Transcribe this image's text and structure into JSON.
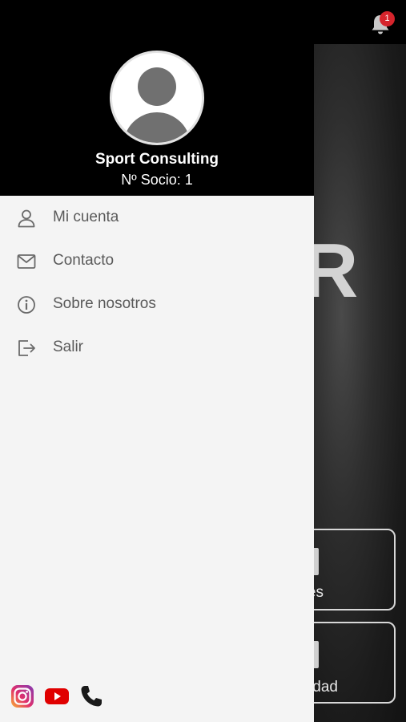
{
  "notifications": {
    "count": "1"
  },
  "background": {
    "hero_letter": "R",
    "tiles": [
      {
        "label": "es"
      },
      {
        "label": "dad"
      }
    ]
  },
  "drawer": {
    "user": {
      "name": "Sport Consulting",
      "member_no": "Nº Socio: 1"
    },
    "menu": [
      {
        "label": "Mi cuenta",
        "icon": "user-icon"
      },
      {
        "label": "Contacto",
        "icon": "mail-icon"
      },
      {
        "label": "Sobre nosotros",
        "icon": "info-icon"
      },
      {
        "label": "Salir",
        "icon": "logout-icon"
      }
    ],
    "social": [
      {
        "name": "instagram-icon"
      },
      {
        "name": "youtube-icon"
      },
      {
        "name": "phone-icon"
      }
    ]
  },
  "colors": {
    "accent_badge": "#d5242c",
    "drawer_bg": "#f4f4f4",
    "header_bg": "#000000",
    "text_menu": "#5a5a5a"
  }
}
